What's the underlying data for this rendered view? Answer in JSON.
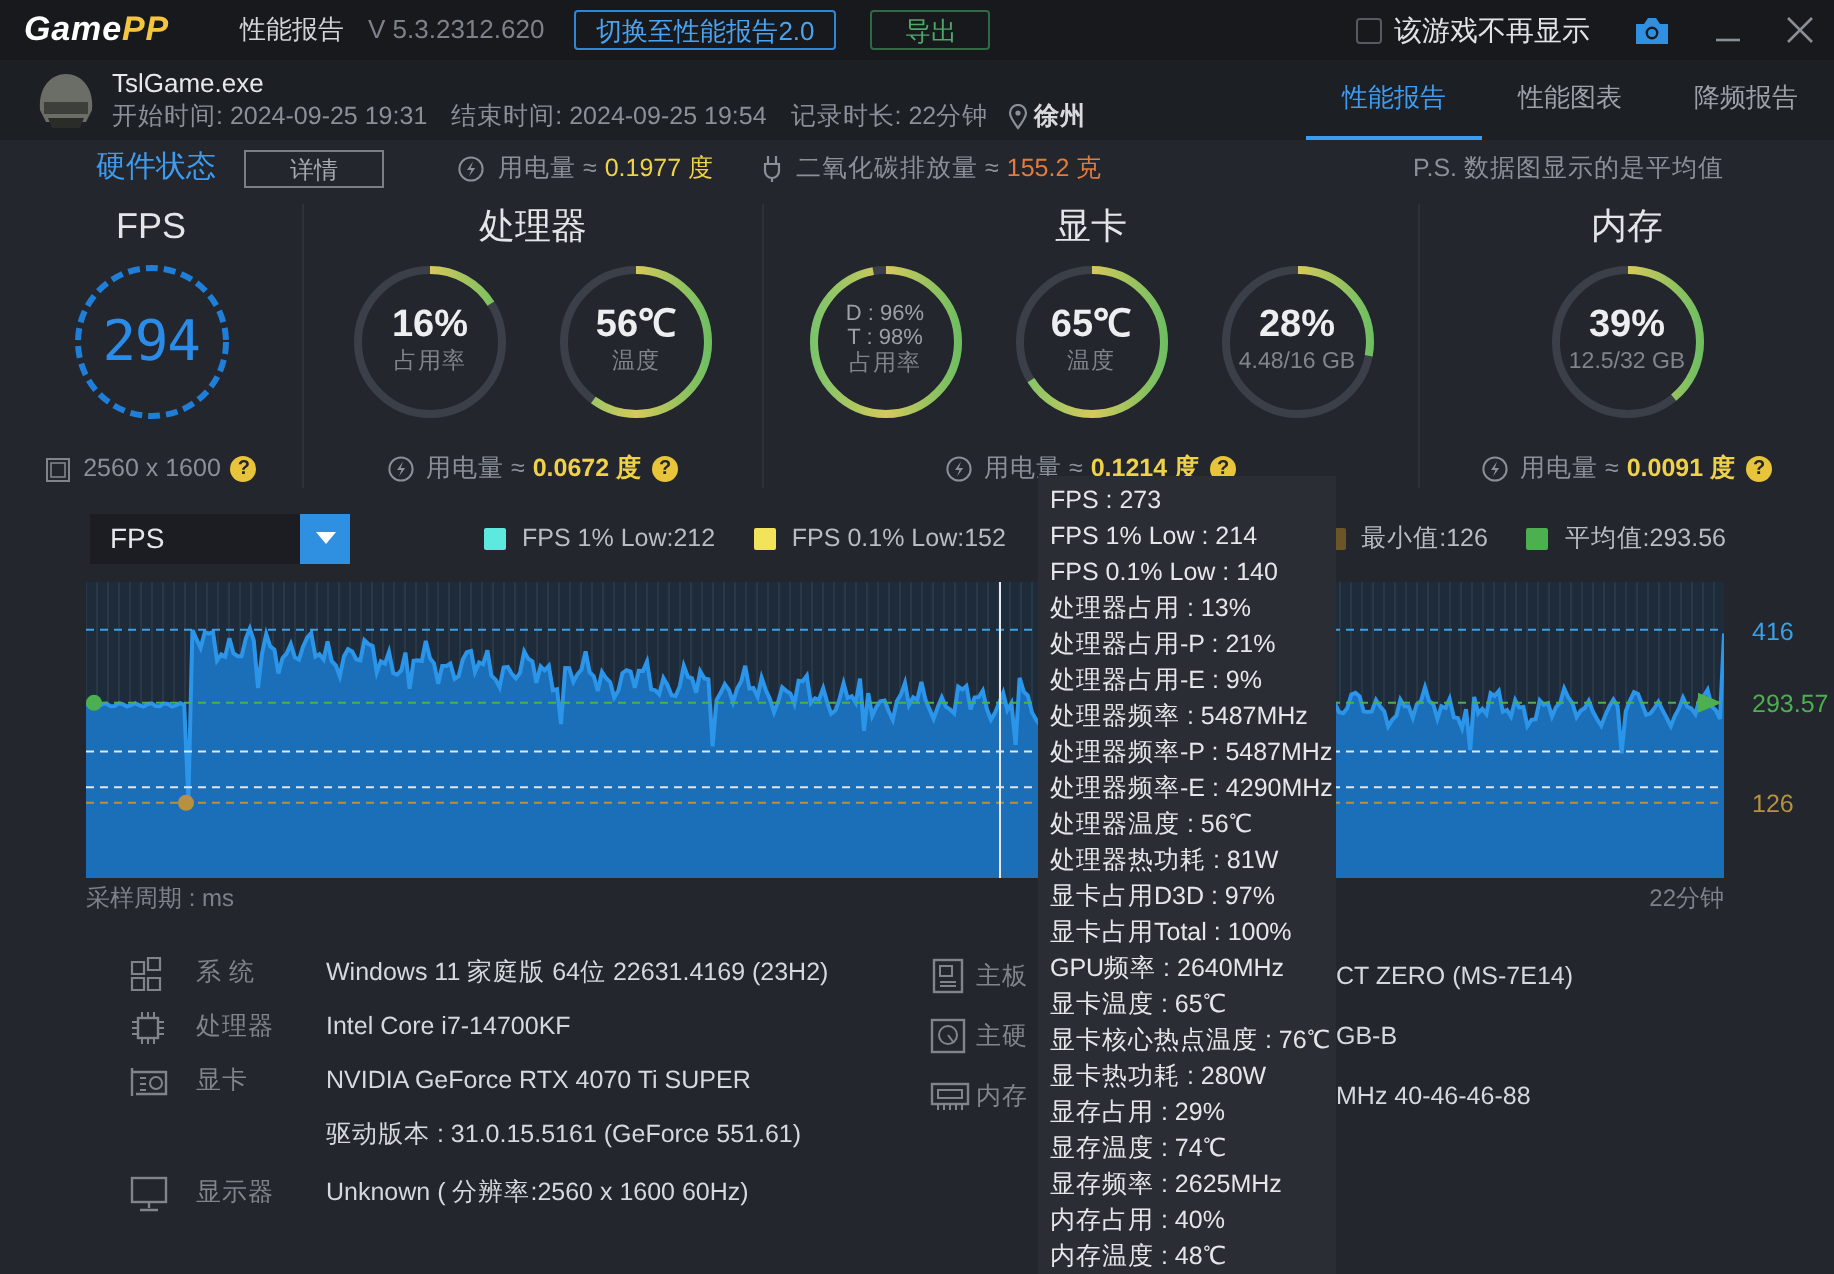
{
  "app": {
    "logo_parts": [
      {
        "text": "Game",
        "color": "#ffffff"
      },
      {
        "text": "PP",
        "color": "#f5c542"
      }
    ],
    "title": "性能报告",
    "version": "V 5.3.2312.620",
    "switch_button": "切换至性能报告2.0",
    "export_button": "导出",
    "hide_checkbox": {
      "label": "该游戏不再显示",
      "checked": false
    }
  },
  "session": {
    "exe": "TslGame.exe",
    "start": "开始时间: 2024-09-25 19:31",
    "end": "结束时间: 2024-09-25 19:54",
    "duration": "记录时长: 22分钟",
    "location": "徐州"
  },
  "tabs": [
    {
      "label": "性能报告",
      "selected": true
    },
    {
      "label": "性能图表",
      "selected": false
    },
    {
      "label": "降频报告",
      "selected": false
    }
  ],
  "hardware_bar": {
    "title": "硬件状态",
    "details_button": "详情",
    "power_label": "用电量 ≈",
    "power_value": "0.1977 度",
    "co2_label": "二氧化碳排放量 ≈",
    "co2_value": "155.2 克",
    "note": "P.S. 数据图显示的是平均值"
  },
  "panels": [
    {
      "title": "FPS",
      "gauges": [
        {
          "kind": "fps",
          "value": "294"
        }
      ],
      "footer": {
        "kind": "resolution",
        "text": "2560 x 1600",
        "help": "?"
      }
    },
    {
      "title": "处理器",
      "gauges": [
        {
          "kind": "ring",
          "value": "16%",
          "label": "占用率",
          "level": 0.16
        },
        {
          "kind": "ring",
          "value": "56℃",
          "label": "温度",
          "level": 0.6
        }
      ],
      "footer": {
        "kind": "power",
        "text": "用电量 ≈",
        "value": "0.0672 度",
        "help": "?"
      }
    },
    {
      "title": "显卡",
      "gauges": [
        {
          "kind": "ring",
          "sub_values": [
            "D : 96%",
            "T : 98%"
          ],
          "label": "占用率",
          "level": 0.97
        },
        {
          "kind": "ring",
          "value": "65℃",
          "label": "温度",
          "level": 0.66
        },
        {
          "kind": "ring",
          "value": "28%",
          "label": "4.48/16 GB",
          "level": 0.28
        }
      ],
      "footer": {
        "kind": "power",
        "text": "用电量 ≈",
        "value": "0.1214 度",
        "help": "?"
      }
    },
    {
      "title": "内存",
      "gauges": [
        {
          "kind": "ring",
          "value": "39%",
          "label": "12.5/32 GB",
          "level": 0.39
        }
      ],
      "footer": {
        "kind": "power",
        "text": "用电量 ≈",
        "value": "0.0091 度",
        "help": "?"
      }
    }
  ],
  "chart": {
    "selector": "FPS",
    "legend": [
      {
        "label": "FPS 1% Low:212",
        "color": "#5ee9e0"
      },
      {
        "label": "FPS 0.1% Low:152",
        "color": "#f2e35a"
      },
      {
        "label": "最小值:126",
        "color": "#6b5428"
      },
      {
        "label": "平均值:293.56",
        "color": "#4caf50"
      }
    ],
    "ref_lines": [
      {
        "label": "416",
        "color": "#3ba0e6"
      },
      {
        "label": "293.57",
        "color": "#4caf50"
      },
      {
        "label": "126",
        "color": "#b8913f"
      }
    ],
    "x_start": "采样周期 : ms",
    "x_end": "22分钟"
  },
  "tooltip": [
    "FPS : 273",
    "FPS 1% Low : 214",
    "FPS 0.1% Low : 140",
    "处理器占用 : 13%",
    "处理器占用-P : 21%",
    "处理器占用-E : 9%",
    "处理器频率 : 5487MHz",
    "处理器频率-P : 5487MHz",
    "处理器频率-E : 4290MHz",
    "处理器温度 : 56℃",
    "处理器热功耗 : 81W",
    "显卡占用D3D : 97%",
    "显卡占用Total : 100%",
    "GPU频率 : 2640MHz",
    "显卡温度 : 65℃",
    "显卡核心热点温度 : 76℃",
    "显卡热功耗 : 280W",
    "显存占用 : 29%",
    "显存温度 : 74℃",
    "显存频率 : 2625MHz",
    "内存占用 : 40%",
    "内存温度 : 48℃"
  ],
  "info_left": [
    {
      "kind": "system",
      "label": "系 统",
      "values": [
        "Windows 11 家庭版 64位 22631.4169 (23H2)"
      ]
    },
    {
      "kind": "cpu",
      "label": "处理器",
      "values": [
        "Intel Core i7-14700KF"
      ]
    },
    {
      "kind": "gpu",
      "label": "显卡",
      "values": [
        "NVIDIA GeForce RTX 4070 Ti SUPER",
        "驱动版本 : 31.0.15.5161 (GeForce 551.61)"
      ]
    },
    {
      "kind": "monitor",
      "label": "显示器",
      "values": [
        "Unknown ( 分辨率:2560 x 1600 60Hz)"
      ]
    }
  ],
  "info_right": [
    {
      "kind": "board",
      "label": "主板",
      "value": "CT ZERO (MS-7E14)"
    },
    {
      "kind": "disk",
      "label": "主硬",
      "value": "GB-B"
    },
    {
      "kind": "ram",
      "label": "内存",
      "value": "MHz 40-46-46-88"
    }
  ]
}
